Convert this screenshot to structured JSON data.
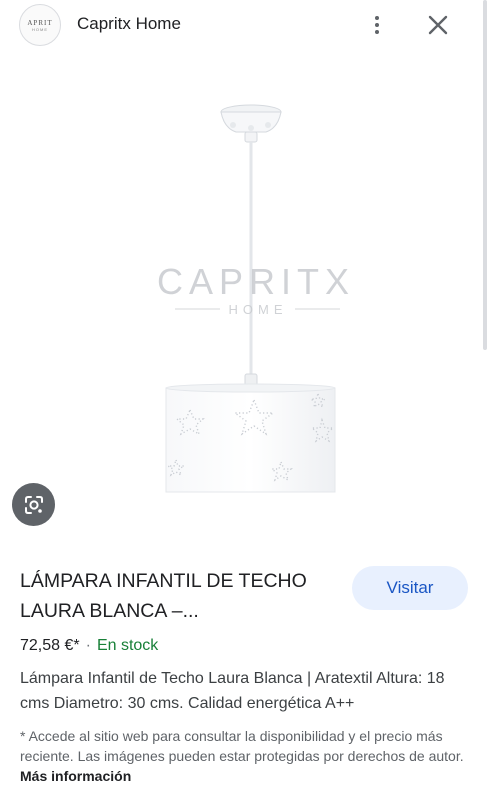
{
  "header": {
    "logo_line1": "APRIT",
    "logo_line2": "HOME",
    "site_name": "Capritx Home"
  },
  "image": {
    "watermark_brand": "CAPRITX",
    "watermark_sub": "HOME",
    "lens_icon": "google-lens-icon"
  },
  "product": {
    "title": "LÁMPARA INFANTIL DE TECHO LAURA BLANCA –...",
    "visit_label": "Visitar",
    "price": "72,58 €*",
    "separator": "·",
    "stock": "En stock",
    "description": "Lámpara Infantil de Techo Laura Blanca | Aratextil Altura: 18 cms Diametro: 30 cms. Calidad energética A++"
  },
  "disclaimer": {
    "text": "* Accede al sitio web para consultar la disponibilidad y el precio más reciente. Las imágenes pueden estar protegidas por derechos de autor. ",
    "link": "Más información"
  },
  "colors": {
    "accent": "#1a56c4",
    "stock_green": "#188038",
    "visit_bg": "#e8f0fe"
  }
}
